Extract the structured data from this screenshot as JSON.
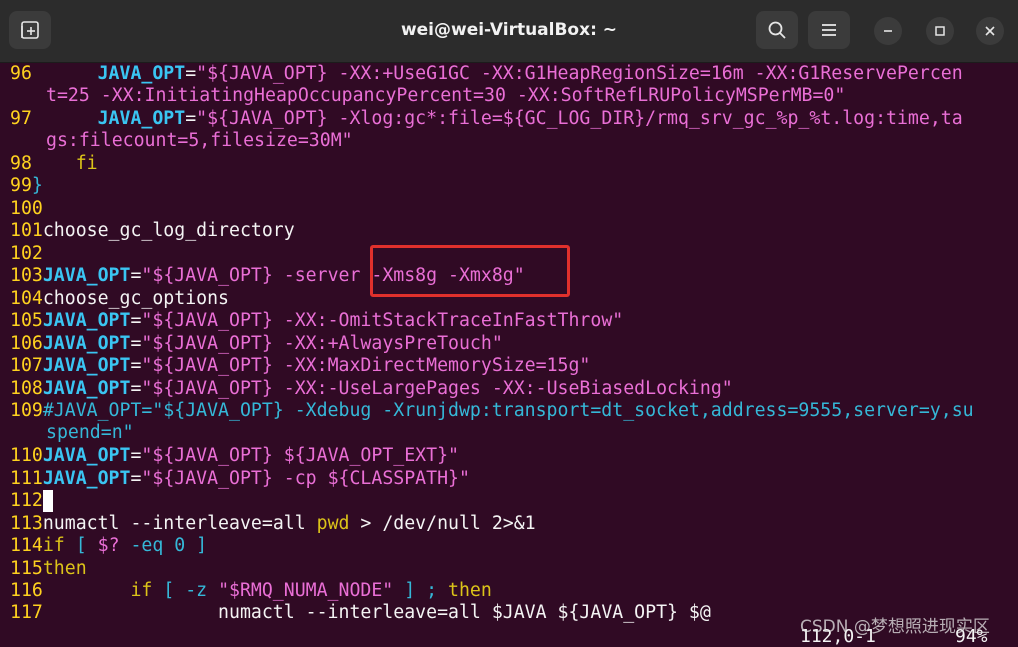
{
  "window": {
    "title": "wei@wei-VirtualBox: ~",
    "new_tab_icon": "new-tab-icon",
    "search_icon": "search-icon",
    "menu_icon": "hamburger-menu-icon"
  },
  "lines": {
    "l96": {
      "n": "96",
      "a": "      JAVA_OPT",
      "b": "=",
      "c": "\"${JAVA_OPT} ",
      "d": "-XX:+UseG1GC -XX:G1HeapRegionSize=16m -XX:G1ReservePercen"
    },
    "l96w": {
      "a": "t=25 -XX:InitiatingHeapOccupancyPercent=30 -XX:SoftRefLRUPolicyMSPerMB=0\""
    },
    "l97": {
      "n": "97",
      "a": "      JAVA_OPT",
      "b": "=",
      "c": "\"${JAVA_OPT} ",
      "d": "-Xlog:gc*:file=${GC_LOG_DIR}/rmq_srv_gc_%p_%t.log:time,ta"
    },
    "l97w": {
      "a": "gs:filecount=5,filesize=30M\""
    },
    "l98": {
      "n": "98",
      "a": "    fi"
    },
    "l99": {
      "n": "99",
      "a": "}"
    },
    "l100": {
      "n": "100"
    },
    "l101": {
      "n": "101",
      "a": "choose_gc_log_directory"
    },
    "l102": {
      "n": "102"
    },
    "l103": {
      "n": "103",
      "a": "JAVA_OPT",
      "b": "=",
      "c": "\"${JAVA_OPT} ",
      "d": "-server -Xms8g -Xmx8g\""
    },
    "l104": {
      "n": "104",
      "a": "choose_gc_options"
    },
    "l105": {
      "n": "105",
      "a": "JAVA_OPT",
      "b": "=",
      "c": "\"${JAVA_OPT} ",
      "d": "-XX:-OmitStackTraceInFastThrow\""
    },
    "l106": {
      "n": "106",
      "a": "JAVA_OPT",
      "b": "=",
      "c": "\"${JAVA_OPT} ",
      "d": "-XX:+AlwaysPreTouch\""
    },
    "l107": {
      "n": "107",
      "a": "JAVA_OPT",
      "b": "=",
      "c": "\"${JAVA_OPT} ",
      "d": "-XX:MaxDirectMemorySize=15g\""
    },
    "l108": {
      "n": "108",
      "a": "JAVA_OPT",
      "b": "=",
      "c": "\"${JAVA_OPT} ",
      "d": "-XX:-UseLargePages -XX:-UseBiasedLocking\""
    },
    "l109": {
      "n": "109",
      "a": "#JAVA_OPT=\"${JAVA_OPT} -Xdebug -Xrunjdwp:transport=dt_socket,address=9555,server=y,su"
    },
    "l109w": {
      "a": "spend=n\""
    },
    "l110": {
      "n": "110",
      "a": "JAVA_OPT",
      "b": "=",
      "c": "\"${JAVA_OPT} ${JAVA_OPT_EXT}\""
    },
    "l111": {
      "n": "111",
      "a": "JAVA_OPT",
      "b": "=",
      "c": "\"${JAVA_OPT} ",
      "d": "-cp ${CLASSPATH}\""
    },
    "l112": {
      "n": "112"
    },
    "l113": {
      "n": "113",
      "a": "numactl --interleave",
      "b": "=",
      "c": "all ",
      "d": "pwd",
      "e": " > /dev/null 2>&1"
    },
    "l114": {
      "n": "114",
      "a": "if",
      "b": " [ ",
      "c": "$?",
      "d": " -eq 0 ]"
    },
    "l115": {
      "n": "115",
      "a": "then"
    },
    "l116": {
      "n": "116",
      "a": "        if",
      "b": " [ -z ",
      "c": "\"$RMQ_NUMA_NODE\"",
      "d": " ] ; ",
      "e": "then"
    },
    "l117": {
      "n": "117",
      "a": "                numactl --interleave",
      "b": "=",
      "c": "all ",
      "d": "$JAVA ${JAVA_OPT} $@"
    }
  },
  "status": {
    "position": "112,0-1",
    "percent": "94%"
  },
  "watermark": "CSDN @梦想照进现实区"
}
